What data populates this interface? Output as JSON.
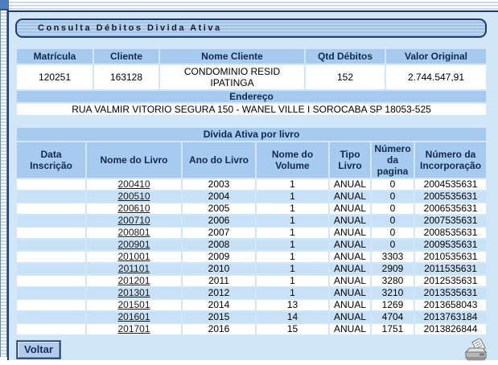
{
  "title_bar": {
    "label": "Consulta Débitos Divida Ativa"
  },
  "client_table": {
    "headers": [
      "Matrícula",
      "Cliente",
      "Nome Cliente",
      "Qtd Débitos",
      "Valor Original"
    ],
    "row": {
      "matricula": "120251",
      "cliente": "163128",
      "nome_cliente": "CONDOMINIO RESID IPATINGA",
      "qtd_debitos": "152",
      "valor_original": "2.744.547,91"
    },
    "endereco_label": "Endereço",
    "endereco_value": "RUA VALMIR VITORIO SEGURA 150 - WANEL VILLE I SOROCABA SP 18053-525"
  },
  "livro_table": {
    "title": "Dívida Ativa por livro",
    "headers": [
      "Data Inscrição",
      "Nome do Livro",
      "Ano do Livro",
      "Nome do Volume",
      "Tipo Livro",
      "Número da pagina",
      "Número da Incorporação"
    ],
    "rows": [
      {
        "data_inscricao": "",
        "nome_livro": "200410",
        "ano": "2003",
        "volume": "1",
        "tipo": "ANUAL",
        "pagina": "0",
        "incorporacao": "2004535631"
      },
      {
        "data_inscricao": "",
        "nome_livro": "200510",
        "ano": "2004",
        "volume": "1",
        "tipo": "ANUAL",
        "pagina": "0",
        "incorporacao": "2005535631"
      },
      {
        "data_inscricao": "",
        "nome_livro": "200610",
        "ano": "2005",
        "volume": "1",
        "tipo": "ANUAL",
        "pagina": "0",
        "incorporacao": "2006535631"
      },
      {
        "data_inscricao": "",
        "nome_livro": "200710",
        "ano": "2006",
        "volume": "1",
        "tipo": "ANUAL",
        "pagina": "0",
        "incorporacao": "2007535631"
      },
      {
        "data_inscricao": "",
        "nome_livro": "200801",
        "ano": "2007",
        "volume": "1",
        "tipo": "ANUAL",
        "pagina": "0",
        "incorporacao": "2008535631"
      },
      {
        "data_inscricao": "",
        "nome_livro": "200901",
        "ano": "2008",
        "volume": "1",
        "tipo": "ANUAL",
        "pagina": "0",
        "incorporacao": "2009535631"
      },
      {
        "data_inscricao": "",
        "nome_livro": "201001",
        "ano": "2009",
        "volume": "1",
        "tipo": "ANUAL",
        "pagina": "3303",
        "incorporacao": "2010535631"
      },
      {
        "data_inscricao": "",
        "nome_livro": "201101",
        "ano": "2010",
        "volume": "1",
        "tipo": "ANUAL",
        "pagina": "2909",
        "incorporacao": "2011535631"
      },
      {
        "data_inscricao": "",
        "nome_livro": "201201",
        "ano": "2011",
        "volume": "1",
        "tipo": "ANUAL",
        "pagina": "3280",
        "incorporacao": "2012535631"
      },
      {
        "data_inscricao": "",
        "nome_livro": "201301",
        "ano": "2012",
        "volume": "1",
        "tipo": "ANUAL",
        "pagina": "3210",
        "incorporacao": "2013535631"
      },
      {
        "data_inscricao": "",
        "nome_livro": "201501",
        "ano": "2014",
        "volume": "13",
        "tipo": "ANUAL",
        "pagina": "1269",
        "incorporacao": "2013658043"
      },
      {
        "data_inscricao": "",
        "nome_livro": "201601",
        "ano": "2015",
        "volume": "14",
        "tipo": "ANUAL",
        "pagina": "4704",
        "incorporacao": "2013763184"
      },
      {
        "data_inscricao": "",
        "nome_livro": "201701",
        "ano": "2016",
        "volume": "15",
        "tipo": "ANUAL",
        "pagina": "1751",
        "incorporacao": "2013826844"
      }
    ]
  },
  "footer": {
    "voltar_label": "Voltar",
    "print_icon": "printer"
  },
  "colors": {
    "panel_bg": "#d2e6f9",
    "header_blue": "#a6cbee",
    "row_alt_blue": "#c9e1f7",
    "border_navy": "#1c3c6e"
  }
}
